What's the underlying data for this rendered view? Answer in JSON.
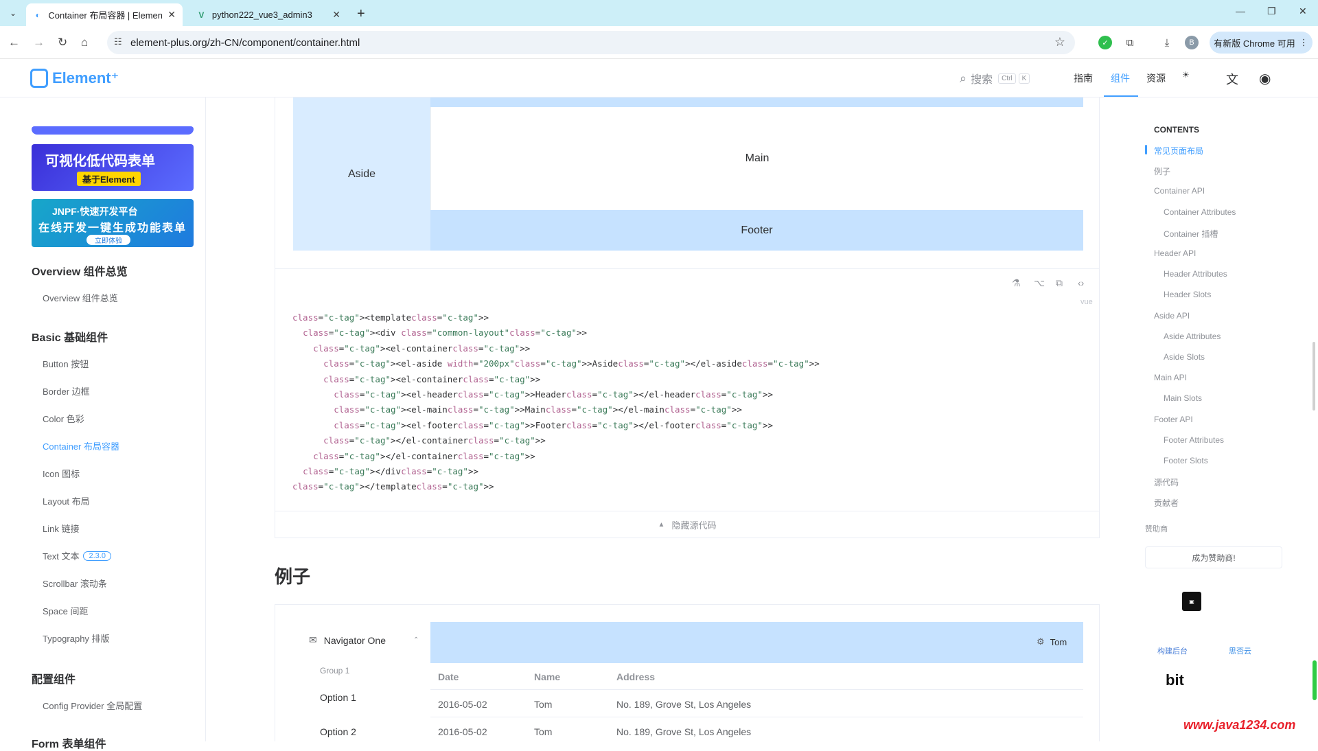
{
  "browser": {
    "tabs": [
      {
        "title": "Container 布局容器 | Element Plus",
        "active": true
      },
      {
        "title": "python222_vue3_admin3",
        "active": false
      }
    ],
    "new_tab": "+",
    "url": "element-plus.org/zh-CN/component/container.html",
    "update_label": "有新版 Chrome 可用",
    "profile_initial": "B"
  },
  "site": {
    "logo_text": "Element⁺",
    "search_placeholder": "搜索",
    "search_kbd": [
      "Ctrl",
      "K"
    ],
    "nav": [
      "指南",
      "组件",
      "资源"
    ],
    "active_nav": "组件"
  },
  "sidebar": {
    "ad1_title": "可视化低代码表单",
    "ad1_tag": "基于Element",
    "ad2_title": "JNPF·快速开发平台",
    "ad2_sub": "在线开发一键生成功能表单",
    "ad2_btn": "立即体验",
    "groups": [
      {
        "title": "Overview 组件总览",
        "items": [
          "Overview 组件总览"
        ]
      },
      {
        "title": "Basic 基础组件",
        "items": [
          "Button 按钮",
          "Border 边框",
          "Color 色彩",
          "Container 布局容器",
          "Icon 图标",
          "Layout 布局",
          "Link 链接",
          "Text 文本",
          "Scrollbar 滚动条",
          "Space 间距",
          "Typography 排版"
        ]
      },
      {
        "title": "配置组件",
        "items": [
          "Config Provider 全局配置"
        ]
      },
      {
        "title": "Form 表单组件",
        "items": []
      }
    ],
    "text_badge": "2.3.0",
    "active_item": "Container 布局容器"
  },
  "demo": {
    "aside": "Aside",
    "main": "Main",
    "footer": "Footer",
    "lang": "vue",
    "code_lines": [
      "<template>",
      "  <div class=\"common-layout\">",
      "    <el-container>",
      "      <el-aside width=\"200px\">Aside</el-aside>",
      "      <el-container>",
      "        <el-header>Header</el-header>",
      "        <el-main>Main</el-main>",
      "        <el-footer>Footer</el-footer>",
      "      </el-container>",
      "    </el-container>",
      "  </div>",
      "</template>"
    ],
    "hide_code": "隐藏源代码"
  },
  "example": {
    "heading": "例子",
    "nav_one": "Navigator One",
    "group1": "Group 1",
    "options": [
      "Option 1",
      "Option 2"
    ],
    "user": "Tom",
    "columns": [
      "Date",
      "Name",
      "Address"
    ],
    "rows": [
      [
        "2016-05-02",
        "Tom",
        "No. 189, Grove St, Los Angeles"
      ],
      [
        "2016-05-02",
        "Tom",
        "No. 189, Grove St, Los Angeles"
      ]
    ]
  },
  "toc": {
    "title": "CONTENTS",
    "items": [
      {
        "label": "常见页面布局",
        "level": 1
      },
      {
        "label": "例子",
        "level": 1
      },
      {
        "label": "Container API",
        "level": 1
      },
      {
        "label": "Container Attributes",
        "level": 2
      },
      {
        "label": "Container 插槽",
        "level": 2
      },
      {
        "label": "Header API",
        "level": 1
      },
      {
        "label": "Header Attributes",
        "level": 2
      },
      {
        "label": "Header Slots",
        "level": 2
      },
      {
        "label": "Aside API",
        "level": 1
      },
      {
        "label": "Aside Attributes",
        "level": 2
      },
      {
        "label": "Aside Slots",
        "level": 2
      },
      {
        "label": "Main API",
        "level": 1
      },
      {
        "label": "Main Slots",
        "level": 2
      },
      {
        "label": "Footer API",
        "level": 1
      },
      {
        "label": "Footer Attributes",
        "level": 2
      },
      {
        "label": "Footer Slots",
        "level": 2
      },
      {
        "label": "源代码",
        "level": 1
      },
      {
        "label": "贡献者",
        "level": 1
      }
    ],
    "sponsor_label": "赞助商",
    "sponsor_button": "成为赞助商!",
    "sponsor_logos": [
      "构建后台",
      "思否云",
      "bit"
    ]
  },
  "watermark": "www.java1234.com",
  "colors": {
    "accent": "#409eff",
    "header_bg": "#c6e2ff",
    "aside_bg": "#d9ecff"
  }
}
